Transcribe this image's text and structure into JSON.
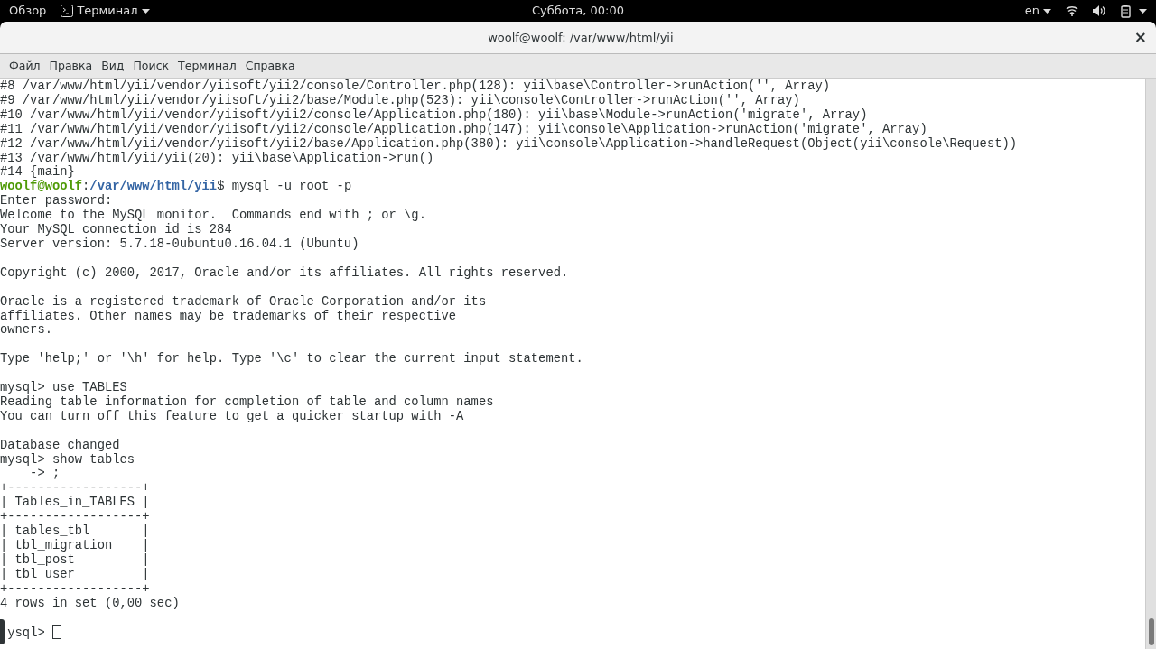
{
  "top_bar": {
    "activities": "Обзор",
    "app_menu": "Терминал",
    "clock": "Суббота, 00:00",
    "keyboard_layout": "en"
  },
  "window": {
    "title": "woolf@woolf: /var/www/html/yii",
    "close": "×"
  },
  "menu": [
    "Файл",
    "Правка",
    "Вид",
    "Поиск",
    "Терминал",
    "Справка"
  ],
  "terminal": {
    "lines": [
      {
        "kind": "text",
        "text": "#8 /var/www/html/yii/vendor/yiisoft/yii2/console/Controller.php(128): yii\\base\\Controller->runAction('', Array)"
      },
      {
        "kind": "text",
        "text": "#9 /var/www/html/yii/vendor/yiisoft/yii2/base/Module.php(523): yii\\console\\Controller->runAction('', Array)"
      },
      {
        "kind": "text",
        "text": "#10 /var/www/html/yii/vendor/yiisoft/yii2/console/Application.php(180): yii\\base\\Module->runAction('migrate', Array)"
      },
      {
        "kind": "text",
        "text": "#11 /var/www/html/yii/vendor/yiisoft/yii2/console/Application.php(147): yii\\console\\Application->runAction('migrate', Array)"
      },
      {
        "kind": "text",
        "text": "#12 /var/www/html/yii/vendor/yiisoft/yii2/base/Application.php(380): yii\\console\\Application->handleRequest(Object(yii\\console\\Request))"
      },
      {
        "kind": "text",
        "text": "#13 /var/www/html/yii/yii(20): yii\\base\\Application->run()"
      },
      {
        "kind": "text",
        "text": "#14 {main}"
      },
      {
        "kind": "prompt",
        "user": "woolf@woolf",
        "separator": ":",
        "path": "/var/www/html/yii",
        "command": "$ mysql -u root -p"
      },
      {
        "kind": "text",
        "text": "Enter password:"
      },
      {
        "kind": "text",
        "text": "Welcome to the MySQL monitor.  Commands end with ; or \\g."
      },
      {
        "kind": "text",
        "text": "Your MySQL connection id is 284"
      },
      {
        "kind": "text",
        "text": "Server version: 5.7.18-0ubuntu0.16.04.1 (Ubuntu)"
      },
      {
        "kind": "blank"
      },
      {
        "kind": "text",
        "text": "Copyright (c) 2000, 2017, Oracle and/or its affiliates. All rights reserved."
      },
      {
        "kind": "blank"
      },
      {
        "kind": "text",
        "text": "Oracle is a registered trademark of Oracle Corporation and/or its"
      },
      {
        "kind": "text",
        "text": "affiliates. Other names may be trademarks of their respective"
      },
      {
        "kind": "text",
        "text": "owners."
      },
      {
        "kind": "blank"
      },
      {
        "kind": "text",
        "text": "Type 'help;' or '\\h' for help. Type '\\c' to clear the current input statement."
      },
      {
        "kind": "blank"
      },
      {
        "kind": "text",
        "text": "mysql> use TABLES"
      },
      {
        "kind": "text",
        "text": "Reading table information for completion of table and column names"
      },
      {
        "kind": "text",
        "text": "You can turn off this feature to get a quicker startup with -A"
      },
      {
        "kind": "blank"
      },
      {
        "kind": "text",
        "text": "Database changed"
      },
      {
        "kind": "text",
        "text": "mysql> show tables"
      },
      {
        "kind": "text",
        "text": "    -> ;"
      },
      {
        "kind": "text",
        "text": "+------------------+"
      },
      {
        "kind": "text",
        "text": "| Tables_in_TABLES |"
      },
      {
        "kind": "text",
        "text": "+------------------+"
      },
      {
        "kind": "text",
        "text": "| tables_tbl       |"
      },
      {
        "kind": "text",
        "text": "| tbl_migration    |"
      },
      {
        "kind": "text",
        "text": "| tbl_post         |"
      },
      {
        "kind": "text",
        "text": "| tbl_user         |"
      },
      {
        "kind": "text",
        "text": "+------------------+"
      },
      {
        "kind": "text",
        "text": "4 rows in set (0,00 sec)"
      },
      {
        "kind": "blank"
      },
      {
        "kind": "input",
        "text": "ysql>"
      }
    ]
  }
}
